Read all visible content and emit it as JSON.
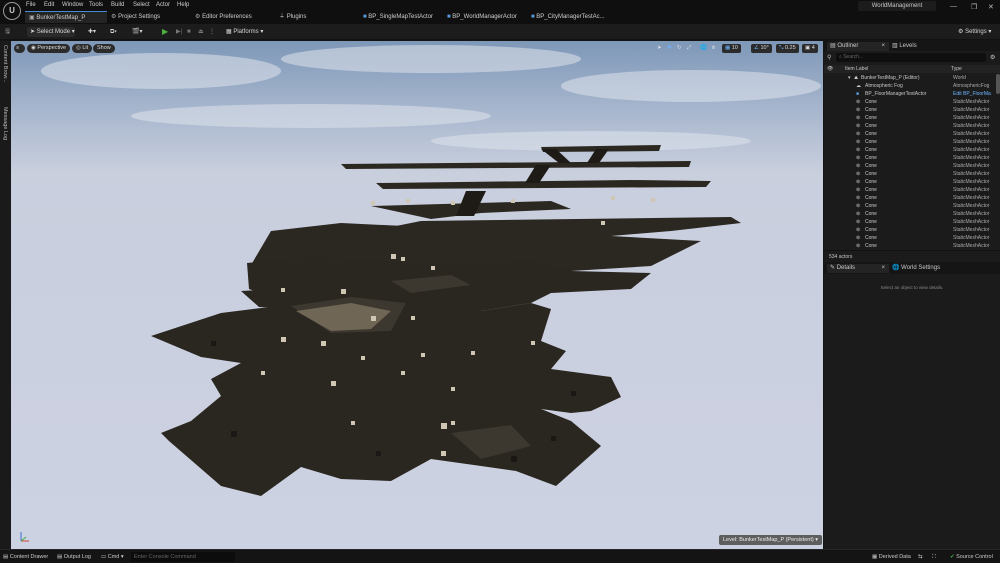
{
  "menu": [
    "File",
    "Edit",
    "Window",
    "Tools",
    "Build",
    "Select",
    "Actor",
    "Help"
  ],
  "project_name": "WorldManagement",
  "tabs": [
    {
      "label": "BunkerTestMap_P",
      "icon": "level-icon"
    },
    {
      "label": "Project Settings",
      "icon": "settings-icon"
    },
    {
      "label": "Editor Preferences",
      "icon": "settings-icon"
    },
    {
      "label": "Plugins",
      "icon": "plug-icon"
    },
    {
      "label": "BP_SingleMapTestActor",
      "icon": "blueprint-icon"
    },
    {
      "label": "BP_WorldManagerActor",
      "icon": "blueprint-icon"
    },
    {
      "label": "BP_CityManagerTestAc...",
      "icon": "blueprint-icon"
    }
  ],
  "toolbar": {
    "select_mode": "Select Mode",
    "platforms": "Platforms",
    "settings": "Settings"
  },
  "left_strip": {
    "content_browser": "Content Brow...",
    "message_log": "Message Log"
  },
  "viewport": {
    "perspective": "Perspective",
    "lit": "Lit",
    "show": "Show",
    "grid_value": "10",
    "angle_value": "10°",
    "scale_value": "0.25",
    "camera_speed": "4",
    "level_label": "Level:  BunkerTestMap_P (Persistent)"
  },
  "outliner": {
    "tab": "Outliner",
    "levels_tab": "Levels",
    "search_placeholder": "Search...",
    "col_label": "Item Label",
    "col_type": "Type",
    "root": {
      "label": "BunkerTestMap_P (Editor)",
      "type": "World"
    },
    "rows": [
      {
        "label": "Atmospheric Fog",
        "type": "AtmosphericFog"
      },
      {
        "label": "BP_FloorManagerTestActor",
        "type": "Edit BP_FloorMa"
      },
      {
        "label": "Cone",
        "type": "StaticMeshActor"
      },
      {
        "label": "Cone",
        "type": "StaticMeshActor"
      },
      {
        "label": "Cone",
        "type": "StaticMeshActor"
      },
      {
        "label": "Cone",
        "type": "StaticMeshActor"
      },
      {
        "label": "Cone",
        "type": "StaticMeshActor"
      },
      {
        "label": "Cone",
        "type": "StaticMeshActor"
      },
      {
        "label": "Cone",
        "type": "StaticMeshActor"
      },
      {
        "label": "Cone",
        "type": "StaticMeshActor"
      },
      {
        "label": "Cone",
        "type": "StaticMeshActor"
      },
      {
        "label": "Cone",
        "type": "StaticMeshActor"
      },
      {
        "label": "Cone",
        "type": "StaticMeshActor"
      },
      {
        "label": "Cone",
        "type": "StaticMeshActor"
      },
      {
        "label": "Cone",
        "type": "StaticMeshActor"
      },
      {
        "label": "Cone",
        "type": "StaticMeshActor"
      },
      {
        "label": "Cone",
        "type": "StaticMeshActor"
      },
      {
        "label": "Cone",
        "type": "StaticMeshActor"
      },
      {
        "label": "Cone",
        "type": "StaticMeshActor"
      },
      {
        "label": "Cone",
        "type": "StaticMeshActor"
      },
      {
        "label": "Cone",
        "type": "StaticMeshActor"
      }
    ],
    "actor_count": "534 actors"
  },
  "details": {
    "tab": "Details",
    "world_settings_tab": "World Settings",
    "empty_message": "Select an object to view details."
  },
  "statusbar": {
    "content_drawer": "Content Drawer",
    "output_log": "Output Log",
    "cmd": "Cmd",
    "console_placeholder": "Enter Console Command",
    "derived_data": "Derived Data",
    "source_control": "Source Control"
  },
  "colors": {
    "accent": "#4a89d8",
    "play": "#4caf3f",
    "panel": "#1b1b1b",
    "floor": "#2a2620",
    "success": "#3cb043"
  }
}
